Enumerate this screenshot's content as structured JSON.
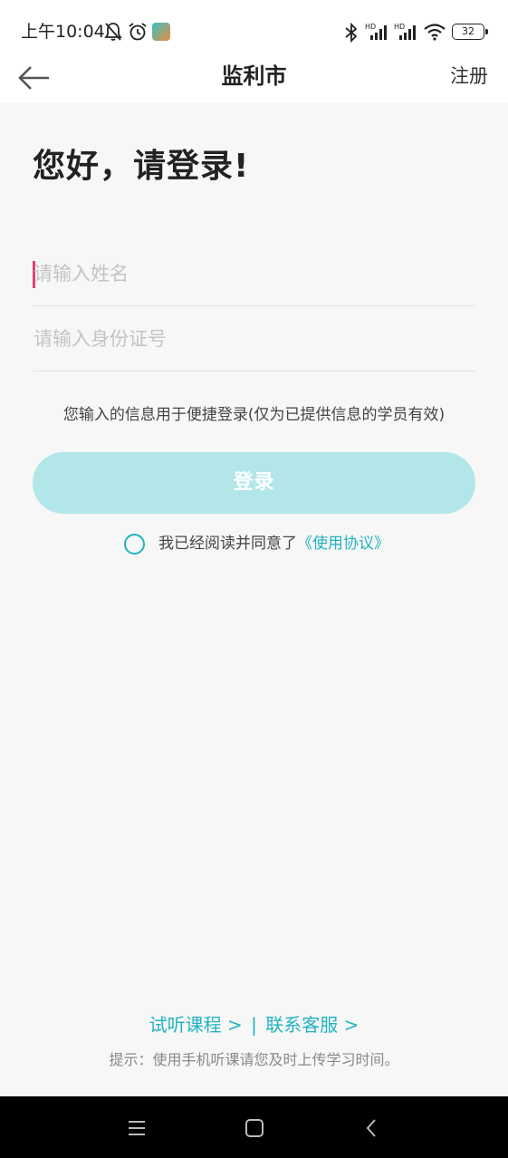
{
  "status_bar": {
    "time": "上午10:04",
    "battery": "32",
    "icons": [
      "mute-bell-icon",
      "alarm-icon",
      "app-notification-icon",
      "bluetooth-icon",
      "signal-hd-icon",
      "signal-hd-icon",
      "wifi-icon",
      "battery-icon"
    ]
  },
  "header": {
    "title": "监利市",
    "register_label": "注册"
  },
  "greeting": "您好，请登录!",
  "form": {
    "name_placeholder": "请输入姓名",
    "id_placeholder": "请输入身份证号",
    "info_text": "您输入的信息用于便捷登录(仅为已提供信息的学员有效)",
    "login_label": "登录",
    "agree_text": "我已经阅读并同意了",
    "agreement_link": "《使用协议》"
  },
  "footer": {
    "trial_link": "试听课程 >",
    "separator": "|",
    "service_link": "联系客服 >",
    "tip": "提示：使用手机听课请您及时上传学习时间。"
  },
  "colors": {
    "accent": "#21b3c0",
    "button_bg": "#b2e6e9",
    "caret": "#e23d7d",
    "page_bg": "#f7f7f7"
  }
}
